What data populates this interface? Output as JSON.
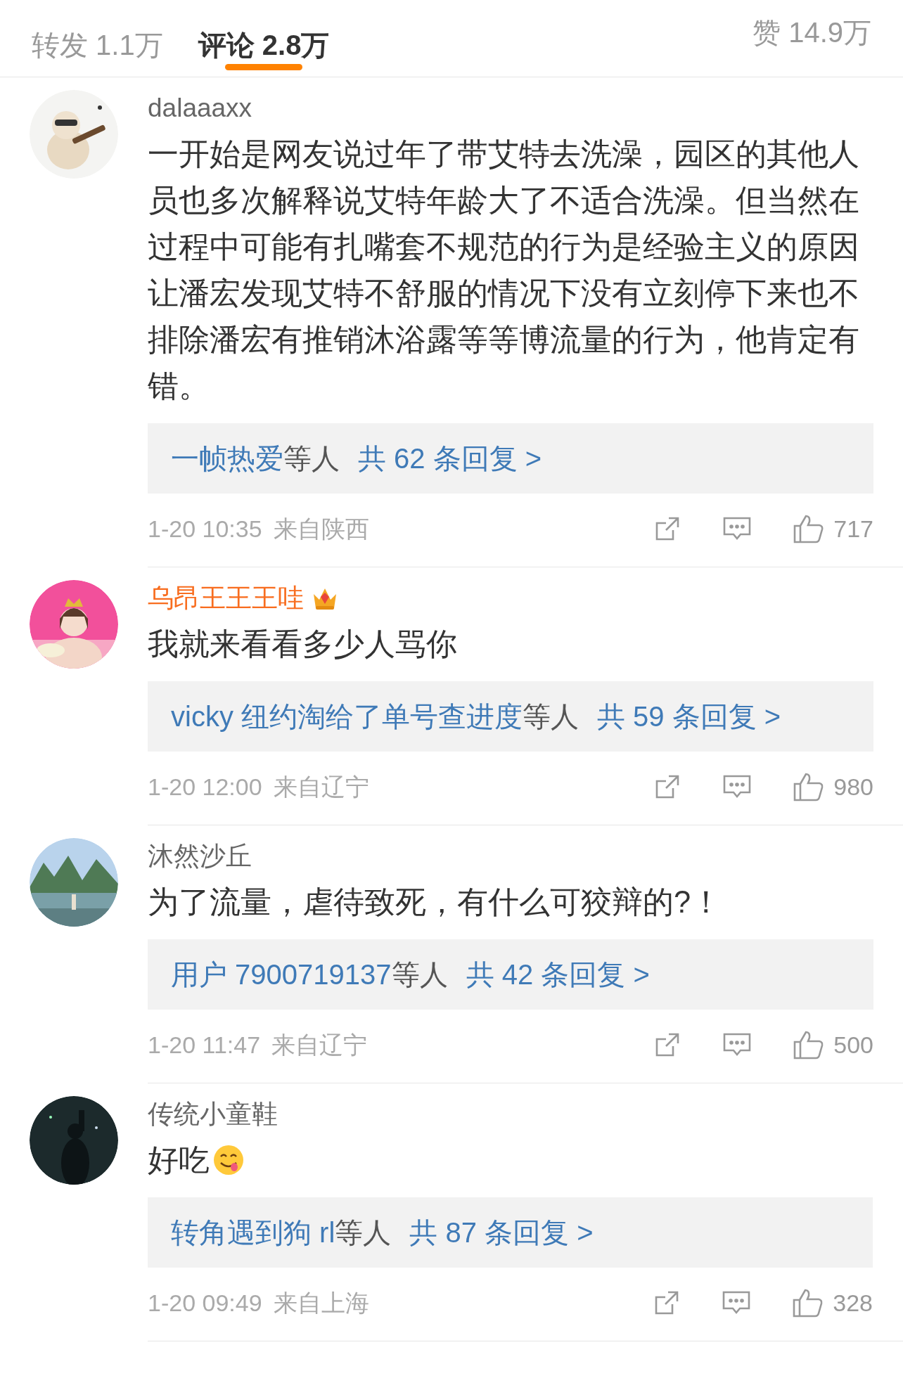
{
  "tabs": [
    {
      "label": "转发 1.1万",
      "selected": false
    },
    {
      "label": "评论 2.8万",
      "selected": true
    }
  ],
  "likes_tab": {
    "label": "赞 14.9万"
  },
  "comments": [
    {
      "name": "dalaaaxx",
      "vip": false,
      "text": "一开始是网友说过年了带艾特去洗澡，园区的其他人员也多次解释说艾特年龄大了不适合洗澡。但当然在过程中可能有扎嘴套不规范的行为是经验主义的原因让潘宏发现艾特不舒服的情况下没有立刻停下来也不排除潘宏有推销沐浴露等等博流量的行为，他肯定有错。",
      "emoji": false,
      "replies": {
        "users": "一帧热爱",
        "others": "等人",
        "total": "共 62 条回复 >"
      },
      "time": "1-20 10:35",
      "location": "来自陕西",
      "likes": "717"
    },
    {
      "name": "乌昂王王王哇",
      "vip": true,
      "text": "我就来看看多少人骂你",
      "emoji": false,
      "replies": {
        "users": "vicky 纽约淘给了单号查进度",
        "others": "等人",
        "total": "共 59 条回复 >"
      },
      "time": "1-20 12:00",
      "location": "来自辽宁",
      "likes": "980"
    },
    {
      "name": "沐然沙丘",
      "vip": false,
      "text": "为了流量，虐待致死，有什么可狡辩的?！",
      "emoji": false,
      "replies": {
        "users": "用户 7900719137",
        "others": "等人",
        "total": "共 42 条回复 >"
      },
      "time": "1-20 11:47",
      "location": "来自辽宁",
      "likes": "500"
    },
    {
      "name": "传统小童鞋",
      "vip": false,
      "text": "好吃",
      "emoji": true,
      "replies": {
        "users": "转角遇到狗 rl",
        "others": "等人",
        "total": "共 87 条回复 >"
      },
      "time": "1-20 09:49",
      "location": "来自上海",
      "likes": "328"
    }
  ]
}
